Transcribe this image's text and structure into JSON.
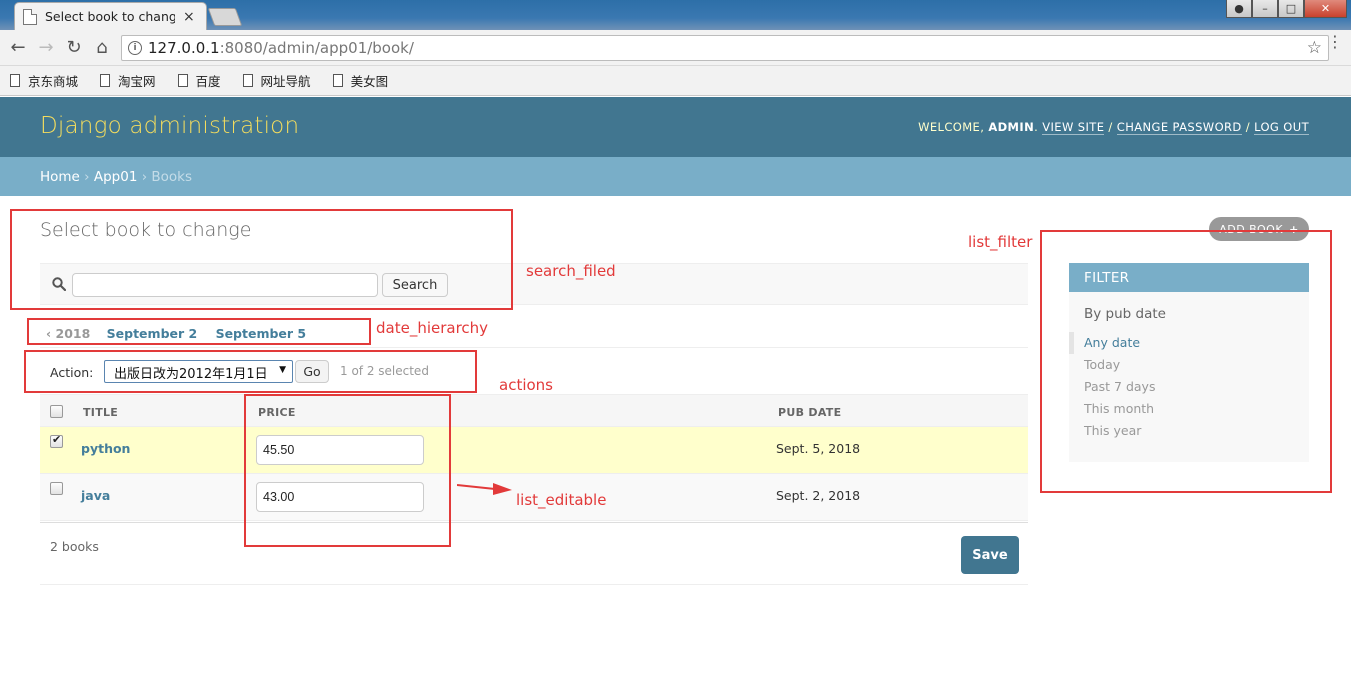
{
  "browser": {
    "tab_title": "Select book to change",
    "tab_close": "×",
    "url_host": "127.0.0.1",
    "url_rest": ":8080/admin/app01/book/",
    "bookmarks": [
      "京东商城",
      "淘宝网",
      "百度",
      "网址导航",
      "美女图"
    ]
  },
  "admin": {
    "branding": "Django administration",
    "welcome": "Welcome, ",
    "username": "admin",
    "view_site": "View site",
    "change_password": "Change password",
    "log_out": "Log out",
    "sep_dot": ". ",
    "sep_slash": " / "
  },
  "breadcrumbs": {
    "home": "Home",
    "app": "App01",
    "current": "Books",
    "sep": " › "
  },
  "page": {
    "title": "Select book to change",
    "add_button": "Add book",
    "add_plus": "+"
  },
  "search": {
    "value": "",
    "button": "Search"
  },
  "date_hierarchy": {
    "back": "‹ 2018",
    "dates": [
      "September 2",
      "September 5"
    ]
  },
  "actions": {
    "label": "Action:",
    "selected_option": "出版日改为2012年1月1日",
    "go": "Go",
    "counter": "1 of 2 selected"
  },
  "table": {
    "columns": [
      "Title",
      "Price",
      "Pub date"
    ],
    "rows": [
      {
        "title": "python",
        "price": "45.50",
        "pub_date": "Sept. 5, 2018",
        "checked": true
      },
      {
        "title": "java",
        "price": "43.00",
        "pub_date": "Sept. 2, 2018",
        "checked": false
      }
    ]
  },
  "paginator": {
    "count": "2 books",
    "save": "Save"
  },
  "filter": {
    "heading": "Filter",
    "by": "By pub date",
    "options": [
      "Any date",
      "Today",
      "Past 7 days",
      "This month",
      "This year"
    ],
    "selected_index": 0
  },
  "annotations": {
    "search": "search_filed",
    "date": "date_hierarchy",
    "actions": "actions",
    "editable": "list_editable",
    "filter": "list_filter"
  },
  "colors": {
    "header": "#417690",
    "breadcrumbs": "#79aec8",
    "branding": "#f5dd5d",
    "link": "#447e9b",
    "annotation": "#e23a3a",
    "selected_row": "#ffffcc"
  }
}
